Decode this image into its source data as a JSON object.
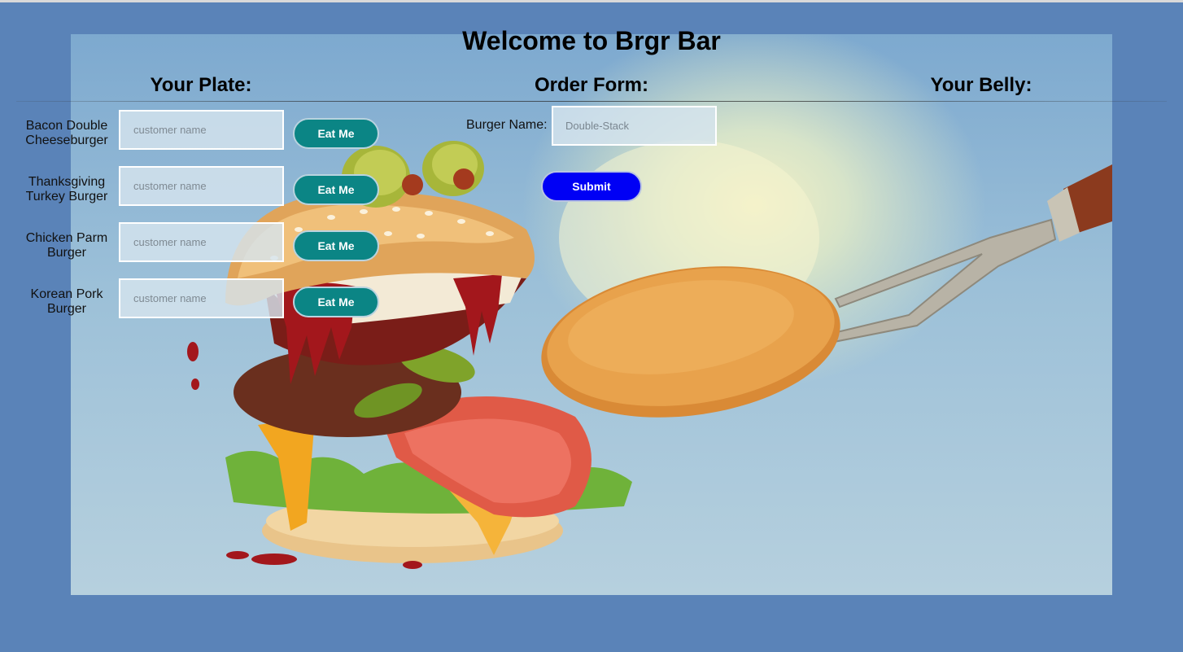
{
  "page": {
    "title": "Welcome to Brgr Bar"
  },
  "columns": {
    "plate": "Your Plate:",
    "order": "Order Form:",
    "belly": "Your Belly:"
  },
  "plate_items": [
    {
      "name": "Bacon Double Cheeseburger",
      "placeholder": "customer name",
      "button": "Eat Me"
    },
    {
      "name": "Thanksgiving Turkey Burger",
      "placeholder": "customer name",
      "button": "Eat Me"
    },
    {
      "name": "Chicken Parm Burger",
      "placeholder": "customer name",
      "button": "Eat Me"
    },
    {
      "name": "Korean Pork Burger",
      "placeholder": "customer name",
      "button": "Eat Me"
    }
  ],
  "order_form": {
    "label": "Burger Name:",
    "placeholder": "Double-Stack",
    "submit": "Submit"
  },
  "colors": {
    "page_bg": "#5a83b8",
    "eat_button": "#0b8585",
    "submit_button": "#0000f5"
  },
  "icons": [
    "burger-monster-illustration",
    "fork-with-patty-illustration"
  ]
}
